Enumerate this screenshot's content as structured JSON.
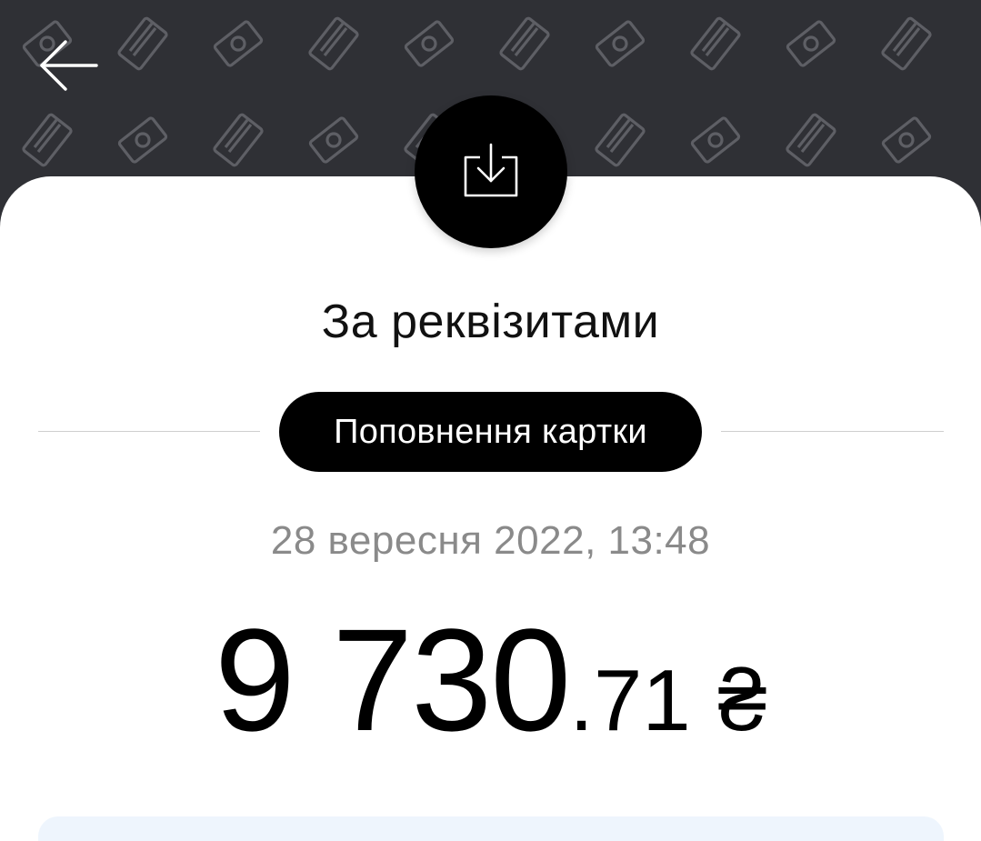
{
  "header": {
    "back_icon": "arrow-left-icon",
    "pattern_icons": [
      "banknote-icon",
      "card-icon"
    ],
    "background_color": "#2f3035"
  },
  "transaction": {
    "type_icon": "download-tray-icon",
    "title": "За реквізитами",
    "category": "Поповнення картки",
    "datetime": "28 вересня 2022, 13:48",
    "amount_integer": "9 730",
    "amount_fraction": ".71",
    "currency": "₴"
  }
}
